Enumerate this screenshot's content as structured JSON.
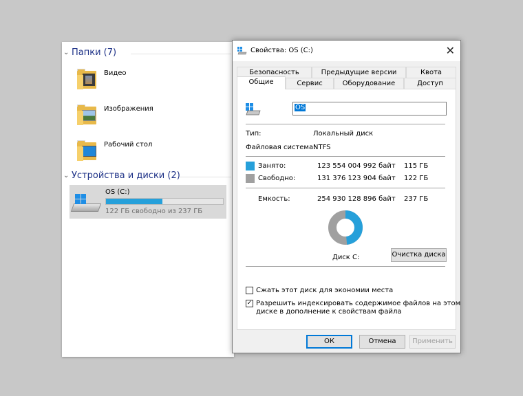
{
  "explorer": {
    "folders_group": {
      "title": "Папки (7)"
    },
    "folders": [
      {
        "label": "Видео",
        "icon": "video-folder-icon"
      },
      {
        "label": "Изображения",
        "icon": "pictures-folder-icon"
      },
      {
        "label": "Рабочий стол",
        "icon": "desktop-folder-icon"
      }
    ],
    "devices_group": {
      "title": "Устройства и диски (2)"
    },
    "drive": {
      "name": "OS (C:)",
      "free_text": "122 ГБ свободно из 237 ГБ",
      "used_fraction": 0.485
    }
  },
  "dialog": {
    "title": "Свойства: OS (C:)",
    "tabs_back": [
      "Безопасность",
      "Предыдущие версии",
      "Квота"
    ],
    "tabs_front": [
      "Общие",
      "Сервис",
      "Оборудование",
      "Доступ"
    ],
    "active_tab": "Общие",
    "name_value": "OS",
    "type_label": "Тип:",
    "type_value": "Локальный диск",
    "fs_label": "Файловая система:",
    "fs_value": "NTFS",
    "used_label": "Занято:",
    "used_bytes": "123 554 004 992 байт",
    "used_gb": "115 ГБ",
    "free_label": "Свободно:",
    "free_bytes": "131 376 123 904 байт",
    "free_gb": "122 ГБ",
    "capacity_label": "Емкость:",
    "capacity_bytes": "254 930 128 896 байт",
    "capacity_gb": "237 ГБ",
    "disk_label": "Диск C:",
    "cleanup_button": "Очистка диска",
    "compress_label": "Сжать этот диск для экономии места",
    "compress_checked": false,
    "index_label_line1": "Разрешить индексировать содержимое файлов на этом",
    "index_label_line2": "диске в дополнение к свойствам файла",
    "index_checked": true,
    "ok_button": "ОК",
    "cancel_button": "Отмена",
    "apply_button": "Применить",
    "colors": {
      "used": "#26a0da",
      "free": "#a0a0a0",
      "accent": "#0078d7"
    }
  }
}
